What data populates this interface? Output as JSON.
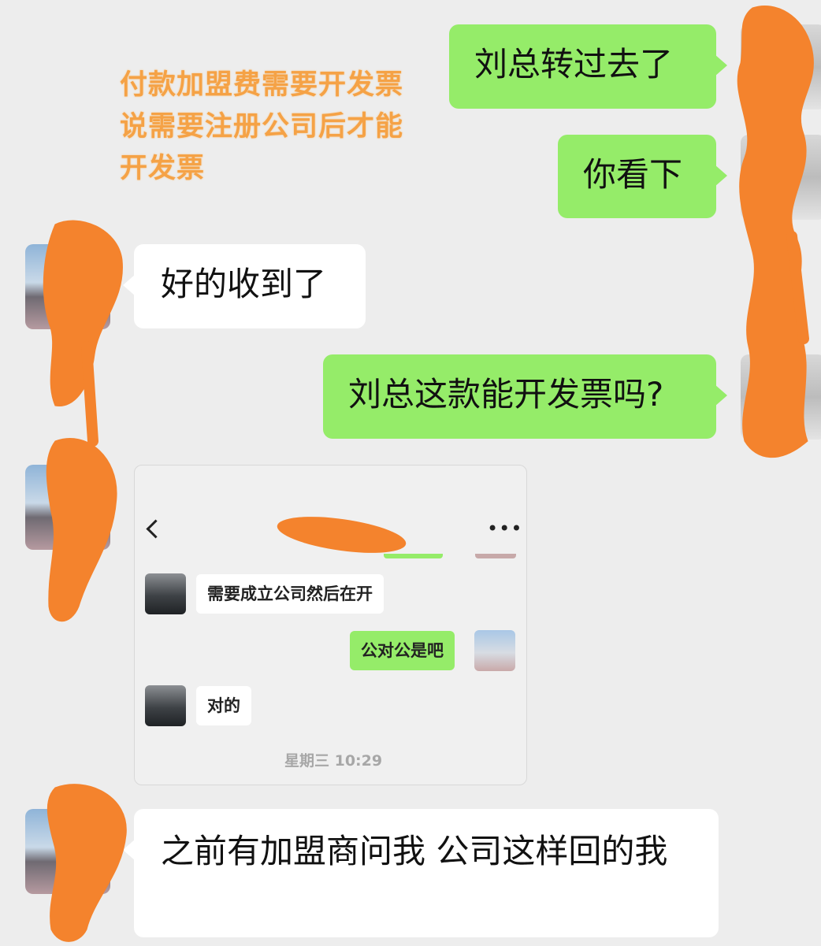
{
  "annotation": {
    "text": "付款加盟费需要开发票说需要注册公司后才能开发票",
    "color": "#f5a246"
  },
  "messages": [
    {
      "side": "right",
      "text": "刘总转过去了"
    },
    {
      "side": "right",
      "text": "你看下"
    },
    {
      "side": "left",
      "text": "好的收到了"
    },
    {
      "side": "right",
      "text": "刘总这款能开发票吗?"
    },
    {
      "side": "left",
      "type": "image"
    },
    {
      "side": "left",
      "text": "之前有加盟商问我 公司这样回的我"
    }
  ],
  "embedded_screenshot": {
    "back_icon": "chevron-left-icon",
    "more_label": "•••",
    "messages": [
      {
        "side": "left",
        "text": "需要成立公司然后在开"
      },
      {
        "side": "right",
        "text": "公对公是吧"
      },
      {
        "side": "left",
        "text": "对的"
      }
    ],
    "timestamp": "星期三 10:29"
  },
  "colors": {
    "background": "#ededed",
    "sent_bubble": "#95ec69",
    "received_bubble": "#ffffff",
    "redaction": "#f4832d"
  }
}
